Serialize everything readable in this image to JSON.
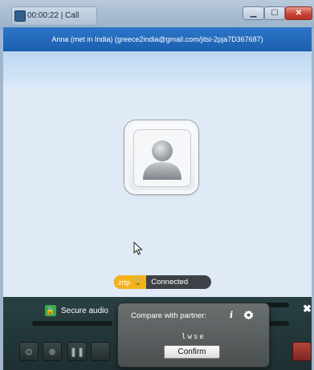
{
  "window": {
    "title": "00:00:22 | Call",
    "contact": "Anna (met in India) (greece2india@gmail.com/jitsi-2pja7D367687)"
  },
  "call": {
    "encryption_label": "zrtp",
    "status": "Connected"
  },
  "bottom_panel": {
    "secure_audio_label": "Secure audio",
    "close_symbol": "✖"
  },
  "sas_popup": {
    "title": "Compare with partner:",
    "sas_code": "lwse",
    "confirm_label": "Confirm"
  },
  "colors": {
    "contact_bar": "#1f66b8",
    "zrtp_badge": "#f3b21b",
    "secure_lock": "#3ea84a"
  },
  "icons": [
    "app-icon",
    "avatar-icon",
    "mouse-cursor-icon",
    "lock-icon",
    "info-icon",
    "gear-icon",
    "close-icon"
  ]
}
